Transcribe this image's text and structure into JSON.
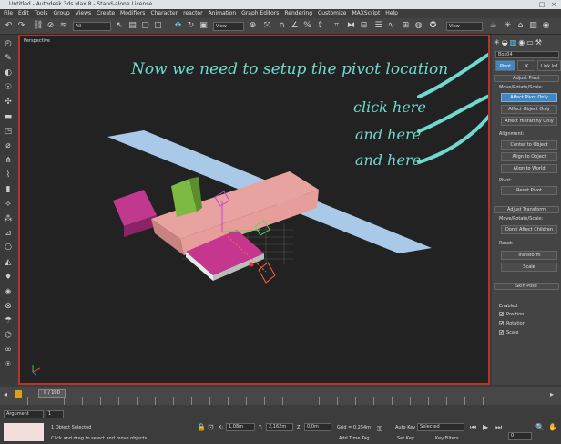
{
  "window": {
    "title": "Untitled - Autodesk 3ds Max 8 - Stand-alone License"
  },
  "menu": [
    "File",
    "Edit",
    "Tools",
    "Group",
    "Views",
    "Create",
    "Modifiers",
    "Character",
    "reactor",
    "Animation",
    "Graph Editors",
    "Rendering",
    "Customize",
    "MAXScript",
    "Help"
  ],
  "toolbar": {
    "selection_filter": "All",
    "ref_coord": "View",
    "render_view": "View"
  },
  "viewport": {
    "label": "Perspective"
  },
  "annotation": {
    "instruction": "Now we need to setup the pivot location",
    "hint1": "click here",
    "hint2": "and here",
    "hint3": "and here"
  },
  "panel": {
    "object_name": "Box04",
    "tabs": {
      "pivot": "Pivot",
      "ik": "IK",
      "link_info": "Link Inf"
    },
    "adjust_pivot": {
      "title": "Adjust Pivot",
      "group": "Move/Rotate/Scale:",
      "affect_pivot": "Affect Pivot Only",
      "affect_object": "Affect Object Only",
      "affect_hierarchy": "Affect Hierarchy Only",
      "alignment": "Alignment:",
      "center_to_object": "Center to Object",
      "align_to_object": "Align to Object",
      "align_to_world": "Align to World",
      "pivot": "Pivot:",
      "reset_pivot": "Reset Pivot"
    },
    "adjust_transform": {
      "title": "Adjust Transform",
      "group": "Move/Rotate/Scale:",
      "dont_affect_children": "Don't Affect Children",
      "reset": "Reset:",
      "transform": "Transform",
      "scale": "Scale"
    },
    "skin_pose": {
      "title": "Skin Pose",
      "enabled_label": "Enabled",
      "position": "Position",
      "rotation": "Rotation",
      "scale": "Scale"
    }
  },
  "timeline": {
    "frame": "0 / 100"
  },
  "status": {
    "listener": "Argument",
    "listener_value": "1",
    "objects_selected": "1 Object Selected",
    "prompt": "Click and drag to select and move objects",
    "x_label": "X:",
    "x_value": "1,08m",
    "y_label": "Y:",
    "y_value": "2,162m",
    "z_label": "Z:",
    "z_value": "0,0m",
    "grid": "Grid = 0,254m",
    "add_time_tag": "Add Time Tag",
    "auto_key": "Auto Key",
    "set_key": "Set Key",
    "selected": "Selected",
    "key_filters": "Key Filters...",
    "current_frame": "0"
  },
  "colors": {
    "accent": "#3f86c2",
    "annotation": "#6fd9d0",
    "viewport_border": "#b8342a"
  }
}
